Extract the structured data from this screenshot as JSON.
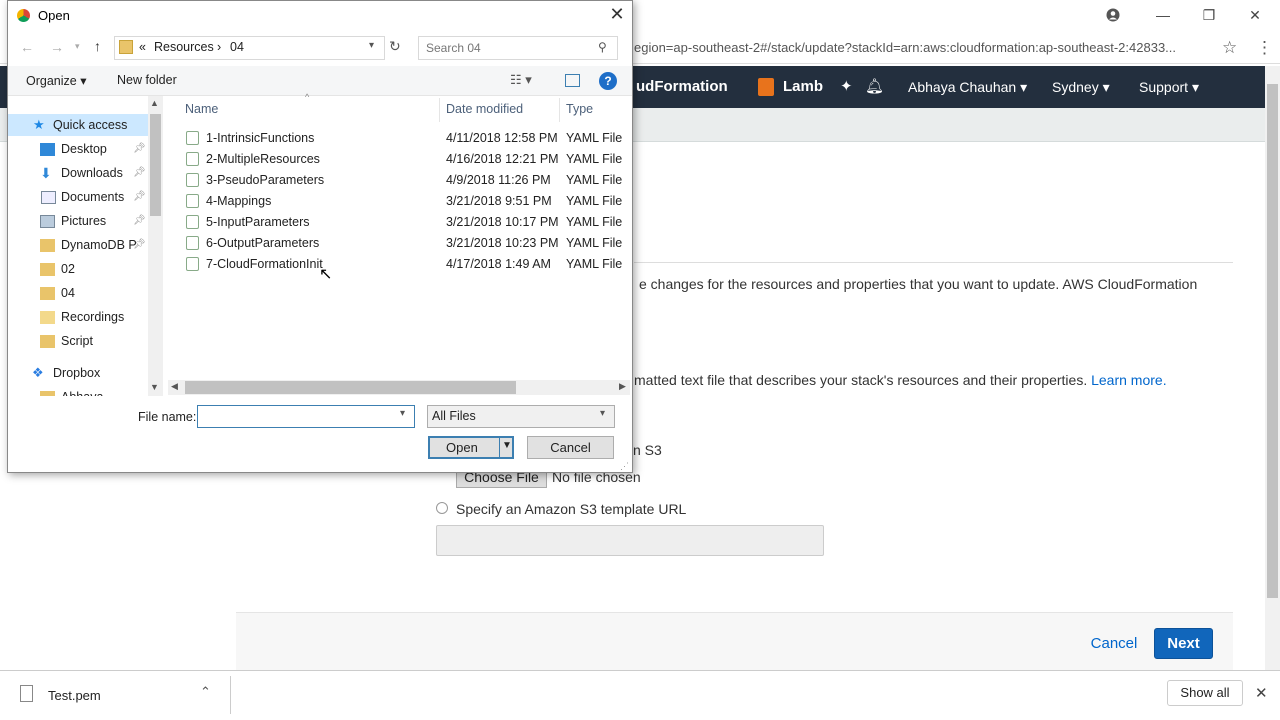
{
  "browser": {
    "address": "egion=ap-southeast-2#/stack/update?stackId=arn:aws:cloudformation:ap-southeast-2:42833..."
  },
  "aws_nav": {
    "service": "udFormation",
    "lambda": "Lamb",
    "user": "Abhaya Chauhan",
    "region": "Sydney",
    "support": "Support"
  },
  "page": {
    "intro": "e changes for the resources and properties that you want to update. AWS CloudFormation",
    "template_desc": "matted text file that describes your stack's resources and their properties.",
    "learn_more": "Learn more.",
    "upload_label": "n S3",
    "choose_file": "Choose File",
    "no_file": "No file chosen",
    "s3_url_label": "Specify an Amazon S3 template URL",
    "cancel": "Cancel",
    "next": "Next"
  },
  "downloads": {
    "file": "Test.pem",
    "show_all": "Show all"
  },
  "dialog": {
    "title": "Open",
    "path_prefix": "«",
    "path_seg1": "Resources",
    "path_sep": "›",
    "path_seg2": "04",
    "search_placeholder": "Search 04",
    "organize": "Organize ▾",
    "new_folder": "New folder",
    "nav": {
      "quick_access": "Quick access",
      "desktop": "Desktop",
      "downloads": "Downloads",
      "documents": "Documents",
      "pictures": "Pictures",
      "dynamodb": "DynamoDB P",
      "f02": "02",
      "f04": "04",
      "recordings": "Recordings",
      "script": "Script",
      "dropbox": "Dropbox",
      "abhaya": "Abhaya"
    },
    "columns": {
      "name": "Name",
      "date": "Date modified",
      "type": "Type"
    },
    "files": [
      {
        "name": "1-IntrinsicFunctions",
        "date": "4/11/2018 12:58 PM",
        "type": "YAML File"
      },
      {
        "name": "2-MultipleResources",
        "date": "4/16/2018 12:21 PM",
        "type": "YAML File"
      },
      {
        "name": "3-PseudoParameters",
        "date": "4/9/2018 11:26 PM",
        "type": "YAML File"
      },
      {
        "name": "4-Mappings",
        "date": "3/21/2018 9:51 PM",
        "type": "YAML File"
      },
      {
        "name": "5-InputParameters",
        "date": "3/21/2018 10:17 PM",
        "type": "YAML File"
      },
      {
        "name": "6-OutputParameters",
        "date": "3/21/2018 10:23 PM",
        "type": "YAML File"
      },
      {
        "name": "7-CloudFormationInit",
        "date": "4/17/2018 1:49 AM",
        "type": "YAML File"
      }
    ],
    "filename_label": "File name:",
    "filename_value": "",
    "filter": "All Files",
    "open": "Open",
    "cancel": "Cancel"
  }
}
